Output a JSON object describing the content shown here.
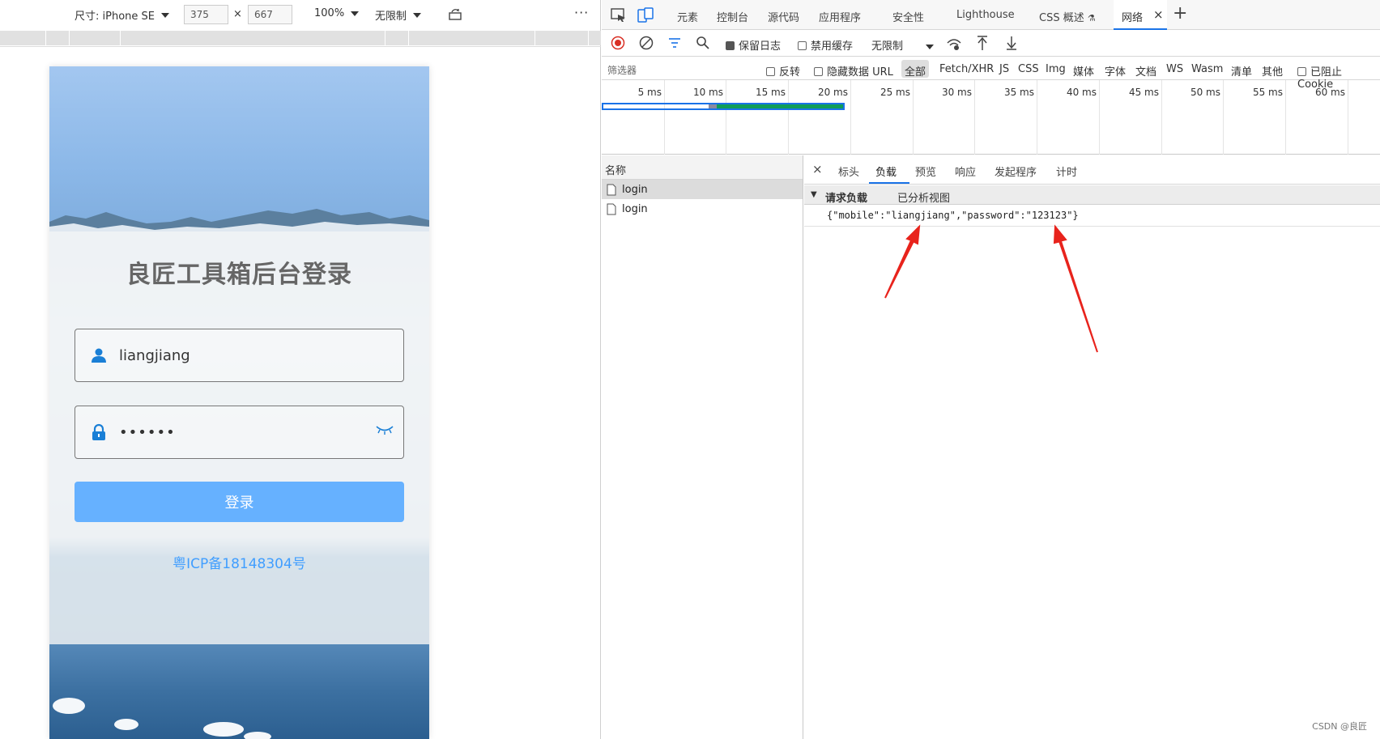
{
  "device_toolbar": {
    "device_label": "尺寸: iPhone SE",
    "width": "375",
    "times": "×",
    "height": "667",
    "zoom": "100%",
    "throttle": "无限制",
    "more": "⋮"
  },
  "login_page": {
    "title": "良匠工具箱后台登录",
    "username_value": "liangjiang",
    "password_value": "••••••",
    "login_button": "登录",
    "icp": "粤ICP备18148304号",
    "colors": {
      "button": "#66b1ff",
      "link": "#409eff"
    }
  },
  "devtools": {
    "tabs": [
      "元素",
      "控制台",
      "源代码",
      "应用程序",
      "安全性",
      "Lighthouse",
      "CSS 概述",
      "网络"
    ],
    "active_tab": "网络",
    "close_tab": "×",
    "add_tab": "+",
    "toolbar": {
      "preserve_log": "保留日志",
      "disable_cache": "禁用缓存",
      "throttle": "无限制"
    },
    "filter": {
      "placeholder": "筛选器",
      "invert": "反转",
      "hide_data_url": "隐藏数据 URL",
      "types": [
        "全部",
        "Fetch/XHR",
        "JS",
        "CSS",
        "Img",
        "媒体",
        "字体",
        "文档",
        "WS",
        "Wasm",
        "清单",
        "其他"
      ],
      "blocked_cookies": "已阻止 Cookie"
    },
    "timeline_ticks": [
      "5 ms",
      "10 ms",
      "15 ms",
      "20 ms",
      "25 ms",
      "30 ms",
      "35 ms",
      "40 ms",
      "45 ms",
      "50 ms",
      "55 ms",
      "60 ms"
    ],
    "requests_header": "名称",
    "requests": [
      "login",
      "login"
    ],
    "detail_tabs": [
      "标头",
      "负载",
      "预览",
      "响应",
      "发起程序",
      "计时"
    ],
    "detail_close": "×",
    "active_detail_tab": "负载",
    "payload_section": "请求负载",
    "parsed_view": "已分析视图",
    "payload_text": "{\"mobile\":\"liangjiang\",\"password\":\"123123\"}"
  },
  "watermark": "CSDN @良匠"
}
